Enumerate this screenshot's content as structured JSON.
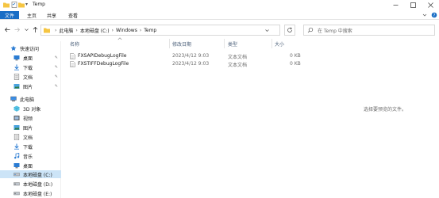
{
  "window": {
    "title": "Temp",
    "qat_dropdown": "▾"
  },
  "ribbon": {
    "tabs": [
      "文件",
      "主页",
      "共享",
      "查看"
    ]
  },
  "address": {
    "crumbs": [
      "此电脑",
      "本地磁盘 (C:)",
      "Windows",
      "Temp"
    ]
  },
  "search": {
    "placeholder": "在 Temp 中搜索"
  },
  "sidebar": {
    "items": [
      {
        "label": "快速访问",
        "icon": "star-icon"
      },
      {
        "label": "桌面",
        "icon": "desktop-folder-icon",
        "pinned": true
      },
      {
        "label": "下载",
        "icon": "download-folder-icon",
        "pinned": true
      },
      {
        "label": "文档",
        "icon": "documents-folder-icon",
        "pinned": true
      },
      {
        "label": "图片",
        "icon": "pictures-folder-icon",
        "pinned": true
      },
      {
        "label": "此电脑",
        "icon": "this-pc-icon"
      },
      {
        "label": "3D 对象",
        "icon": "3d-objects-icon"
      },
      {
        "label": "视频",
        "icon": "videos-folder-icon"
      },
      {
        "label": "图片",
        "icon": "pictures-folder-icon"
      },
      {
        "label": "文档",
        "icon": "documents-folder-icon"
      },
      {
        "label": "下载",
        "icon": "download-folder-icon"
      },
      {
        "label": "音乐",
        "icon": "music-folder-icon"
      },
      {
        "label": "桌面",
        "icon": "desktop-folder-icon"
      },
      {
        "label": "本地磁盘 (C:)",
        "icon": "drive-icon",
        "selected": true
      },
      {
        "label": "本地磁盘 (D:)",
        "icon": "drive-icon"
      },
      {
        "label": "本地磁盘 (E:)",
        "icon": "drive-icon"
      }
    ]
  },
  "filelist": {
    "columns": [
      "名称",
      "修改日期",
      "类型",
      "大小"
    ],
    "rows": [
      {
        "name": "FXSAPIDebugLogFile",
        "modified": "2023/4/12 9:03",
        "type": "文本文档",
        "size": "0 KB"
      },
      {
        "name": "FXSTIFFDebugLogFile",
        "modified": "2023/4/12 9:03",
        "type": "文本文档",
        "size": "0 KB"
      }
    ]
  },
  "preview": {
    "message": "选择要预览的文件。"
  },
  "colors": {
    "accent": "#1a6ec5",
    "selection": "#cce4f7",
    "folder": "#f5c542"
  }
}
